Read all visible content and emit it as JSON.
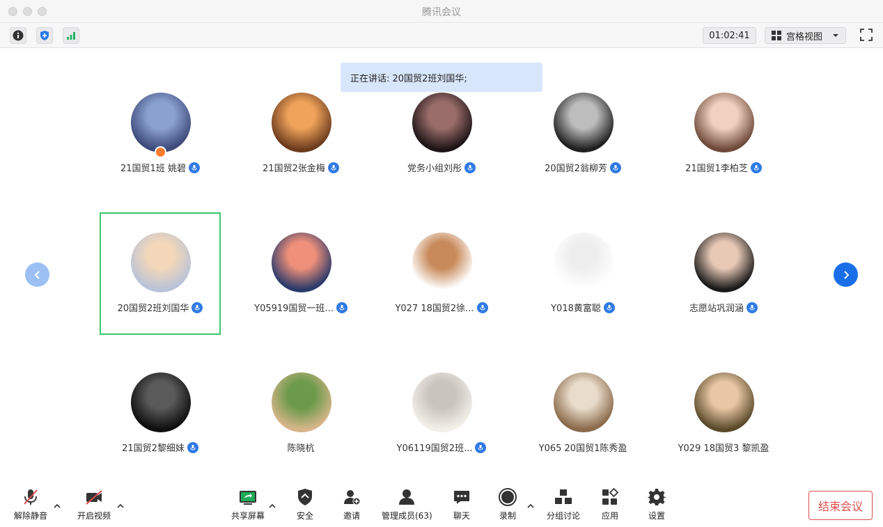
{
  "window": {
    "title": "腾讯会议"
  },
  "toolbar": {
    "timer": "01:02:41",
    "view_label": "宫格视图"
  },
  "speaking": {
    "text": "正在讲话: 20国贸2班刘国华;"
  },
  "participants": [
    {
      "name": "21国贸1班 姚碧",
      "mic": true,
      "host": true,
      "colors": [
        "#3d4a7a",
        "#8ba2d1"
      ]
    },
    {
      "name": "21国贸2张金梅",
      "mic": true,
      "host": false,
      "colors": [
        "#6b3b1e",
        "#f0a35a"
      ]
    },
    {
      "name": "党务小组刘彤",
      "mic": true,
      "host": false,
      "colors": [
        "#1d1416",
        "#9a6d6a"
      ]
    },
    {
      "name": "20国贸2翁柳芳",
      "mic": true,
      "host": false,
      "colors": [
        "#1f1f1f",
        "#bdbdbd"
      ]
    },
    {
      "name": "21国贸1李柏芝",
      "mic": true,
      "host": false,
      "colors": [
        "#6e4a3a",
        "#f1d0bf"
      ]
    },
    {
      "name": "20国贸2班刘国华",
      "mic": true,
      "host": false,
      "active": true,
      "colors": [
        "#b9c3d8",
        "#f3d7b8"
      ]
    },
    {
      "name": "Y05919国贸一班...",
      "mic": true,
      "host": false,
      "colors": [
        "#2a3a6a",
        "#f0907a"
      ]
    },
    {
      "name": "Y027 18国贸2徐...",
      "mic": true,
      "host": false,
      "colors": [
        "#ffffff",
        "#c88a5a"
      ]
    },
    {
      "name": "Y018黄富聪",
      "mic": true,
      "host": false,
      "colors": [
        "#ffffff",
        "#eeeeee"
      ]
    },
    {
      "name": "志愿站巩润涵",
      "mic": true,
      "host": false,
      "colors": [
        "#1a1a1a",
        "#e8c9b6"
      ]
    },
    {
      "name": "21国贸2黎细妹",
      "mic": true,
      "host": false,
      "colors": [
        "#0e0e0e",
        "#5a5a5a"
      ]
    },
    {
      "name": "陈晓杭",
      "mic": false,
      "host": false,
      "colors": [
        "#d7b58a",
        "#6a9a4a"
      ]
    },
    {
      "name": "Y06119国贸2班...",
      "mic": true,
      "host": false,
      "colors": [
        "#f2efe9",
        "#c9c4bd"
      ]
    },
    {
      "name": "Y065 20国贸1陈秀盈",
      "mic": false,
      "host": false,
      "colors": [
        "#8a6a4a",
        "#e9dccb"
      ]
    },
    {
      "name": "Y029 18国贸3 黎凯盈",
      "mic": false,
      "host": false,
      "colors": [
        "#5a4a2a",
        "#e8c7a5"
      ]
    }
  ],
  "bottom": {
    "mute_label": "解除静音",
    "video_label": "开启视频",
    "share_label": "共享屏幕",
    "security_label": "安全",
    "invite_label": "邀请",
    "members_label": "管理成员(63)",
    "chat_label": "聊天",
    "record_label": "录制",
    "breakout_label": "分组讨论",
    "apps_label": "应用",
    "settings_label": "设置",
    "end_label": "结束会议"
  },
  "colors": {
    "accent": "#2f7ae5",
    "active_border": "#3cc46a",
    "danger": "#e04c4c",
    "share_green": "#1faa57"
  },
  "icons": [
    "info-icon",
    "shield-icon",
    "signal-icon",
    "grid-icon",
    "fullscreen-icon",
    "mic-off-icon",
    "video-off-icon",
    "share-screen-icon",
    "security-icon",
    "invite-icon",
    "members-icon",
    "chat-icon",
    "record-icon",
    "breakout-icon",
    "apps-icon",
    "settings-icon"
  ]
}
